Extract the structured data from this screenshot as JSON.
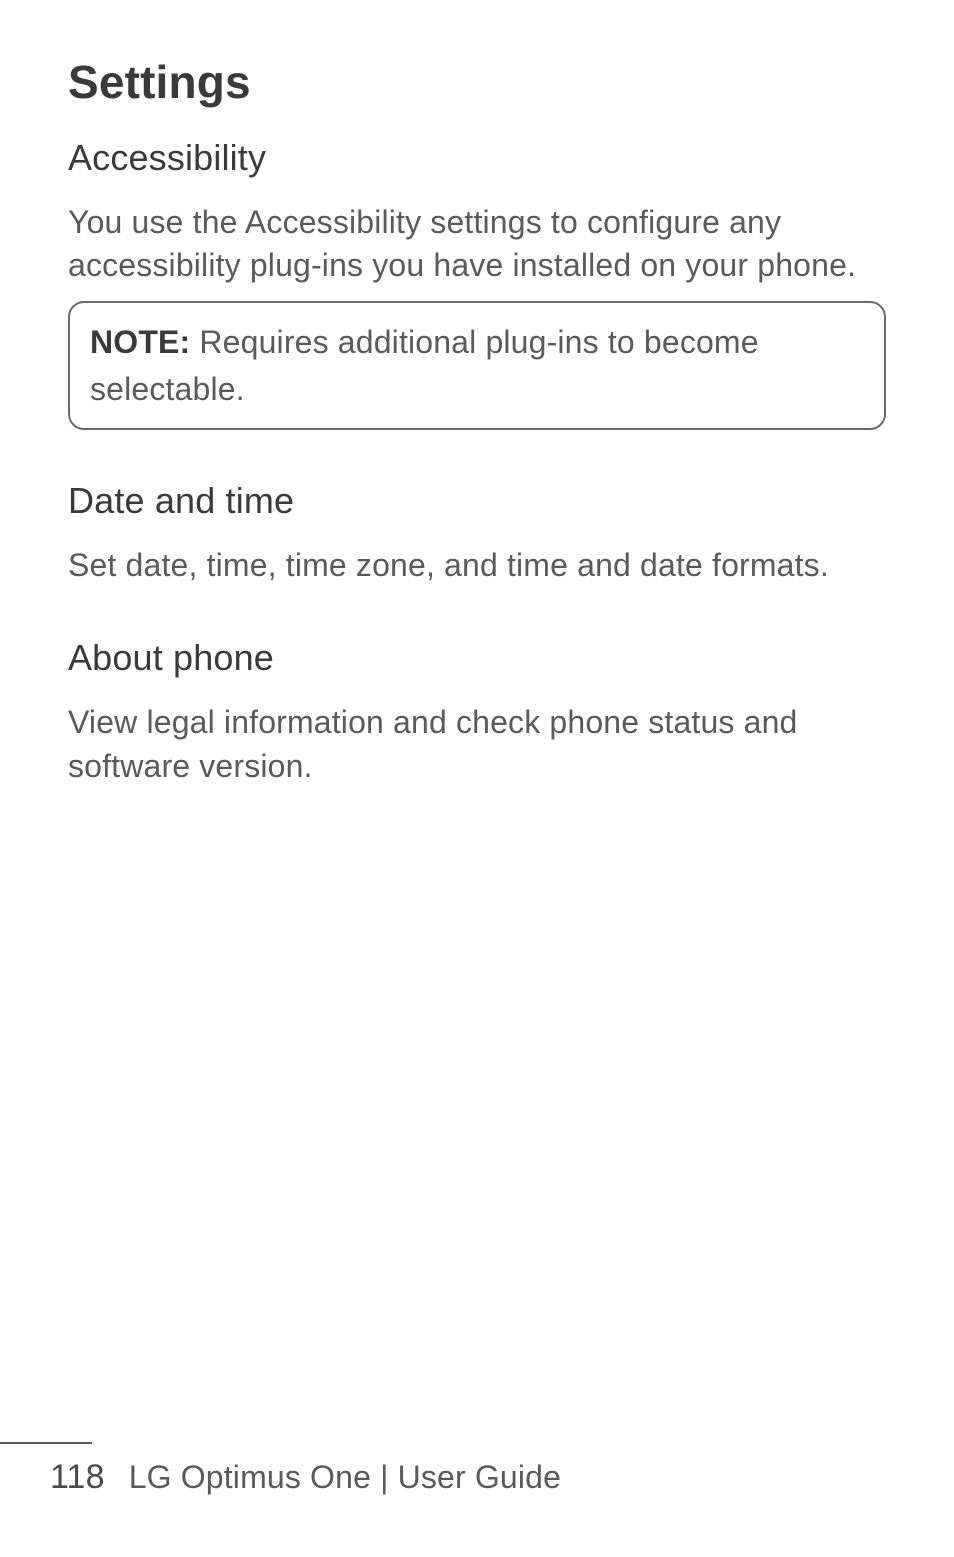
{
  "page": {
    "title": "Settings",
    "sections": [
      {
        "heading": "Accessibility",
        "body": "You use the Accessibility settings to configure any accessibility plug-ins you have installed on your phone.",
        "note_label": "NOTE:",
        "note_text": " Requires additional plug-ins to become selectable."
      },
      {
        "heading": "Date and time",
        "body": "Set date, time, time zone, and time and date formats."
      },
      {
        "heading": "About phone",
        "body": "View legal information and check phone status and software version."
      }
    ]
  },
  "footer": {
    "page_number": "118",
    "product": "LG Optimus One",
    "separator": "  |  ",
    "doc_type": "User Guide"
  }
}
